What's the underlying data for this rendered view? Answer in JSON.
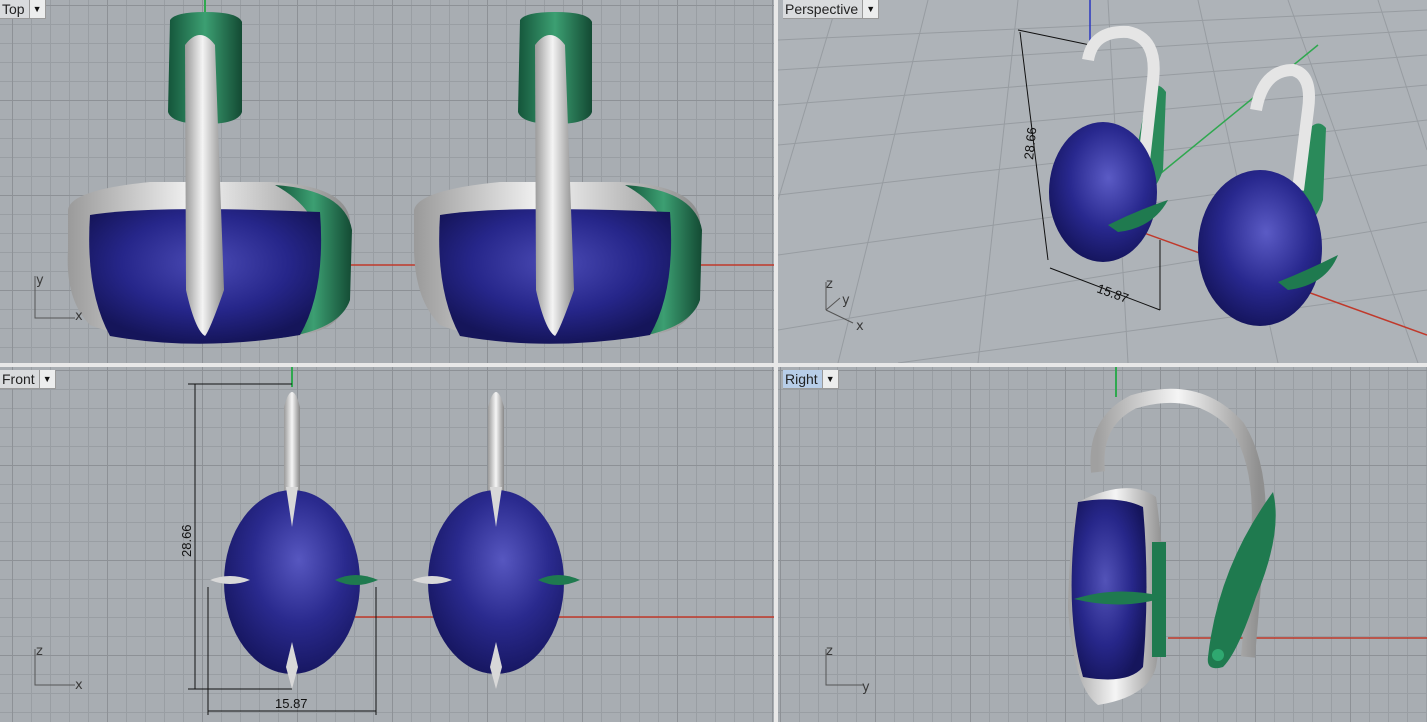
{
  "viewports": {
    "top": {
      "name": "Top",
      "axis_h": "x",
      "axis_v": "y"
    },
    "persp": {
      "name": "Perspective",
      "axis_h": "x",
      "axis_v": "z",
      "axis_d": "y",
      "dim_height": "28.66",
      "dim_width": "15.87"
    },
    "front": {
      "name": "Front",
      "axis_h": "x",
      "axis_v": "z",
      "dim_height": "28.66",
      "dim_width": "15.87"
    },
    "right": {
      "name": "Right",
      "axis_h": "y",
      "axis_v": "z"
    }
  },
  "colors": {
    "grid_bg": "#a8adb2",
    "gem": "#2a2a8a",
    "silver": "#d9d9d9",
    "green_part": "#1f7a4f",
    "axis_x": "#c0392b",
    "axis_y": "#2fa84f",
    "axis_z": "#2a36c0",
    "active_tab": "#b7cde8"
  },
  "icons": {
    "dropdown": "chevron-down-icon"
  }
}
